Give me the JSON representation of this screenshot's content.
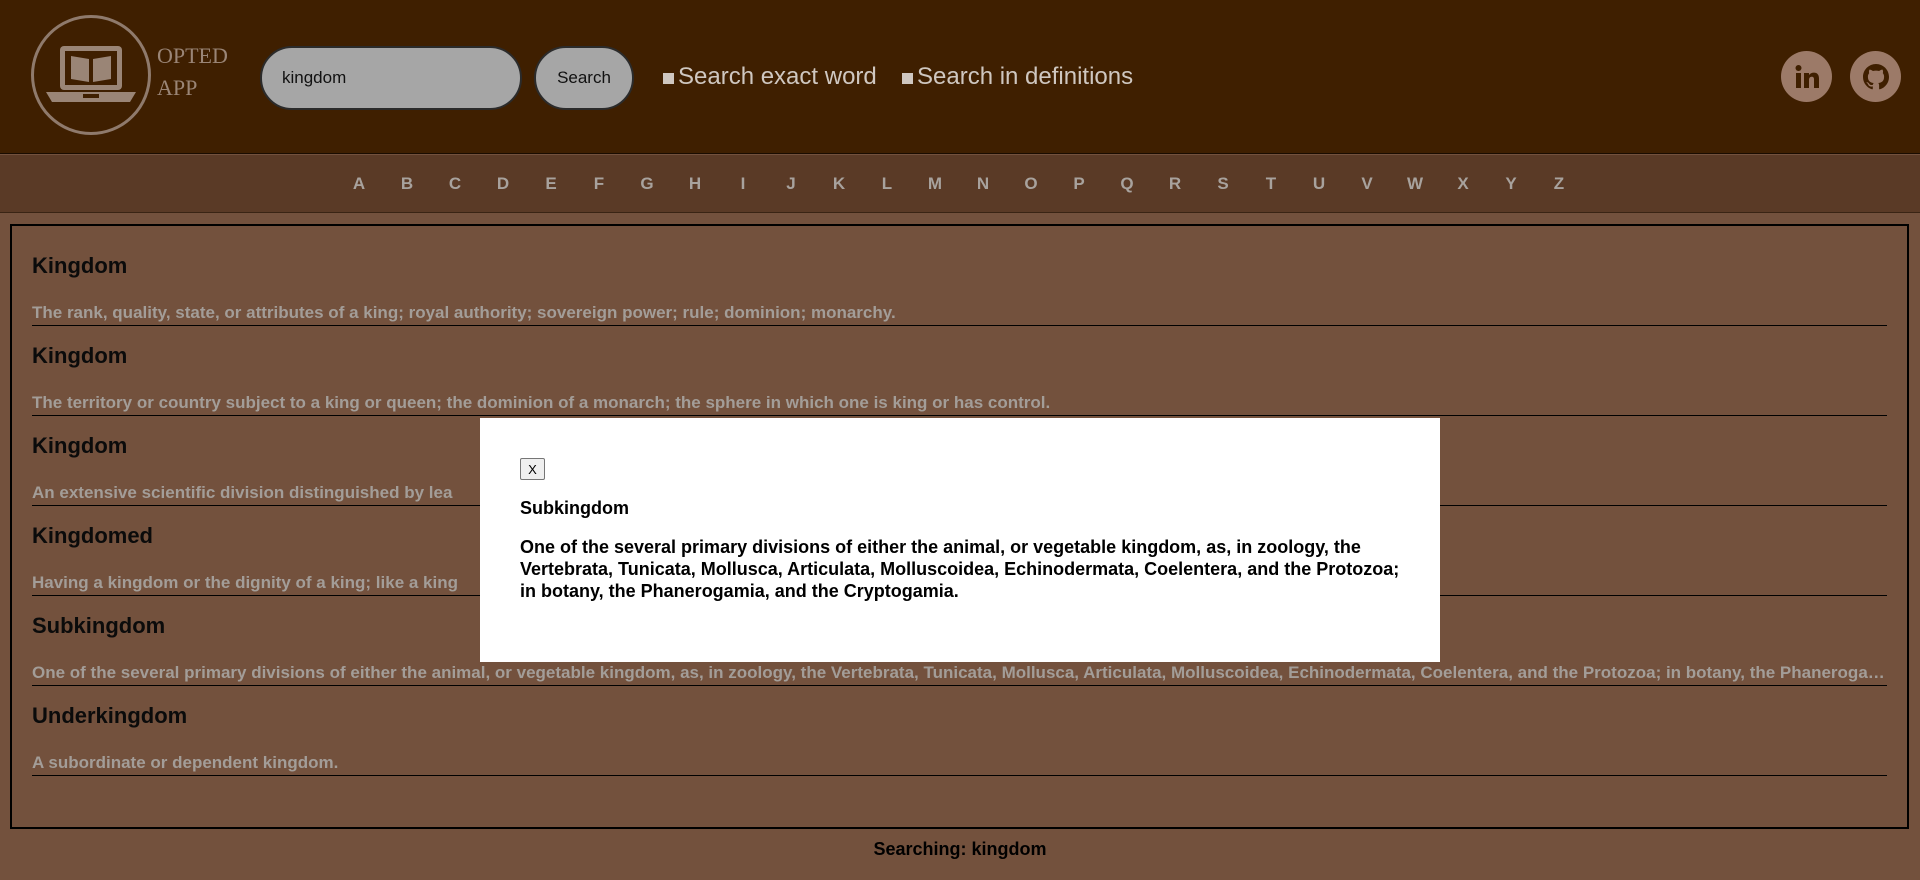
{
  "header": {
    "app_name_line1": "OPTED",
    "app_name_line2": "APP",
    "search_value": "kingdom",
    "search_button_label": "Search",
    "option_exact_label": "Search exact word",
    "option_definitions_label": "Search in definitions",
    "social_icons": [
      "linkedin-icon",
      "github-icon"
    ]
  },
  "alphabet": [
    "A",
    "B",
    "C",
    "D",
    "E",
    "F",
    "G",
    "H",
    "I",
    "J",
    "K",
    "L",
    "M",
    "N",
    "O",
    "P",
    "Q",
    "R",
    "S",
    "T",
    "U",
    "V",
    "W",
    "X",
    "Y",
    "Z"
  ],
  "results": [
    {
      "word": "Kingdom",
      "definition": "The rank, quality, state, or attributes of a king; royal authority; sovereign power; rule; dominion; monarchy."
    },
    {
      "word": "Kingdom",
      "definition": "The territory or country subject to a king or queen; the dominion of a monarch; the sphere in which one is king or has control."
    },
    {
      "word": "Kingdom",
      "definition": "An extensive scientific division distinguished by lea"
    },
    {
      "word": "Kingdomed",
      "definition": "Having a kingdom or the dignity of a king; like a king"
    },
    {
      "word": "Subkingdom",
      "definition": "One of the several primary divisions of either the animal, or vegetable kingdom, as, in zoology, the Vertebrata, Tunicata, Mollusca, Articulata, Molluscoidea, Echinodermata, Coelentera, and the Protozoa; in botany, the Phanerogamia, and the Cryptogamia."
    },
    {
      "word": "Underkingdom",
      "definition": "A subordinate or dependent kingdom."
    }
  ],
  "status": "Searching: kingdom",
  "modal": {
    "close_label": "X",
    "word": "Subkingdom",
    "definition": "One of the several primary divisions of either the animal, or vegetable kingdom, as, in zoology, the Vertebrata, Tunicata, Mollusca, Articulata, Molluscoidea, Echinodermata, Coelentera, and the Protozoa; in botany, the Phanerogamia, and the Cryptogamia."
  },
  "colors": {
    "header_bg": "#3f1f00",
    "page_bg": "#73513d",
    "nav_bg": "#5a3a26",
    "muted_text": "#a39d98"
  }
}
